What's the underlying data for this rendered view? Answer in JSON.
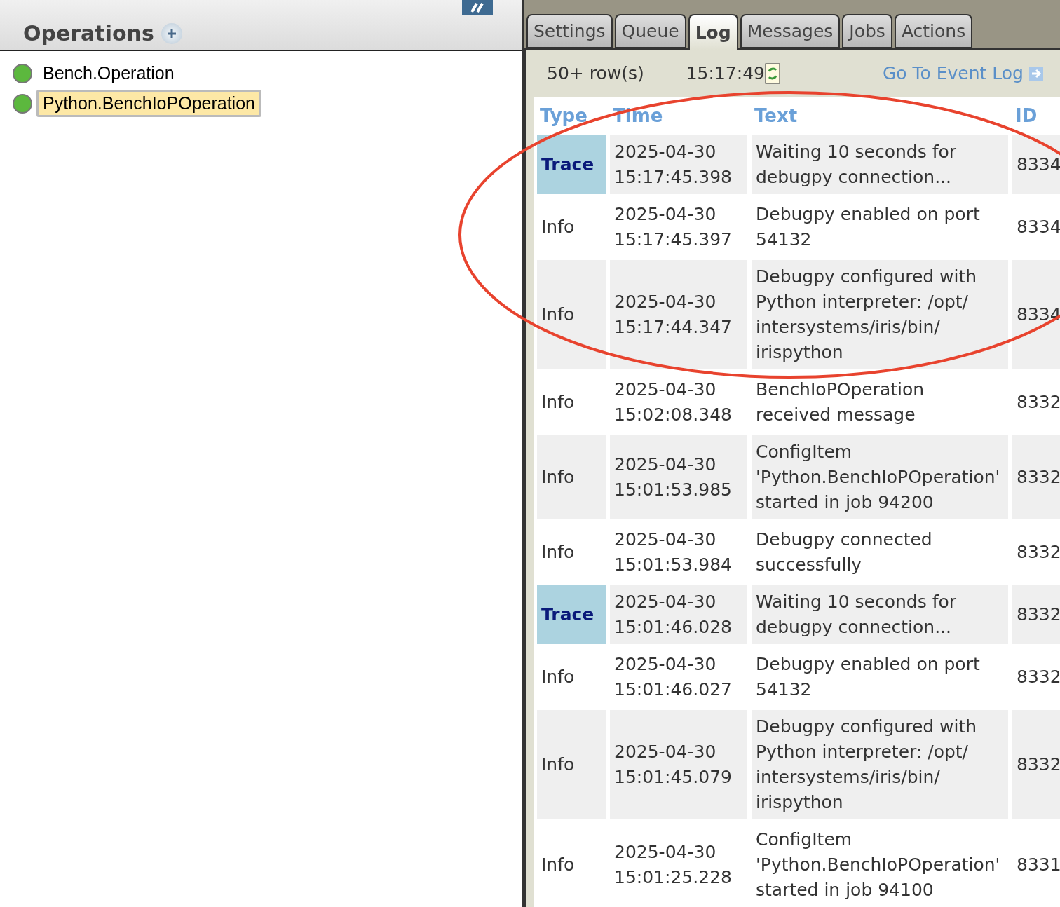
{
  "left_panel": {
    "title": "Operations",
    "items": [
      {
        "label": "Bench.Operation",
        "color": "#5cb83e",
        "selected": false
      },
      {
        "label": "Python.BenchIoPOperation",
        "color": "#5cb83e",
        "selected": true
      }
    ]
  },
  "right_panel": {
    "tabs": [
      {
        "label": "Settings",
        "selected": false
      },
      {
        "label": "Queue",
        "selected": false
      },
      {
        "label": "Log",
        "selected": true
      },
      {
        "label": "Messages",
        "selected": false
      },
      {
        "label": "Jobs",
        "selected": false
      },
      {
        "label": "Actions",
        "selected": false
      }
    ],
    "toolbar": {
      "row_count": "50+ row(s)",
      "time": "15:17:49",
      "event_log_link": "Go To Event Log"
    },
    "table": {
      "columns": [
        "Type",
        "Time",
        "Text",
        "ID"
      ],
      "rows": [
        {
          "kind": "trace",
          "type": "Trace",
          "date": "2025-04-30",
          "time": "15:17:45.398",
          "text": "Waiting 10 seconds for debugpy connection...",
          "id": "8334"
        },
        {
          "kind": "info",
          "type": "Info",
          "date": "2025-04-30",
          "time": "15:17:45.397",
          "text": "Debugpy enabled on port 54132",
          "id": "8334"
        },
        {
          "kind": "info",
          "type": "Info",
          "date": "2025-04-30",
          "time": "15:17:44.347",
          "text": "Debugpy configured with Python interpreter: /opt/ intersystems/iris/bin/ irispython",
          "id": "8334"
        },
        {
          "kind": "info",
          "type": "Info",
          "date": "2025-04-30",
          "time": "15:02:08.348",
          "text": "BenchIoPOperation received message",
          "id": "8332"
        },
        {
          "kind": "info",
          "type": "Info",
          "date": "2025-04-30",
          "time": "15:01:53.985",
          "text": "ConfigItem 'Python.BenchIoPOperation' started in job 94200",
          "id": "8332"
        },
        {
          "kind": "info",
          "type": "Info",
          "date": "2025-04-30",
          "time": "15:01:53.984",
          "text": "Debugpy connected successfully",
          "id": "8332"
        },
        {
          "kind": "trace",
          "type": "Trace",
          "date": "2025-04-30",
          "time": "15:01:46.028",
          "text": "Waiting 10 seconds for debugpy connection...",
          "id": "8332"
        },
        {
          "kind": "info",
          "type": "Info",
          "date": "2025-04-30",
          "time": "15:01:46.027",
          "text": "Debugpy enabled on port 54132",
          "id": "8332"
        },
        {
          "kind": "info",
          "type": "Info",
          "date": "2025-04-30",
          "time": "15:01:45.079",
          "text": "Debugpy configured with Python interpreter: /opt/ intersystems/iris/bin/ irispython",
          "id": "8332"
        },
        {
          "kind": "info",
          "type": "Info",
          "date": "2025-04-30",
          "time": "15:01:25.228",
          "text": "ConfigItem 'Python.BenchIoPOperation' started in job 94100",
          "id": "8331"
        }
      ]
    }
  }
}
